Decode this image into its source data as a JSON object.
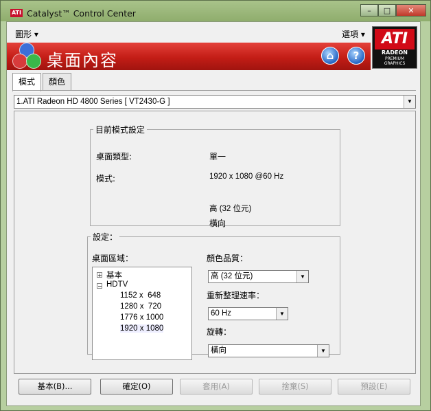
{
  "window": {
    "title": "Catalyst™ Control Center",
    "app_icon_text": "ATI",
    "minimize": "–",
    "maximize": "□",
    "close": "✕"
  },
  "menu": {
    "graphics": "圖形 ▾",
    "options": "選項 ▾"
  },
  "banner": {
    "title": "桌面內容",
    "home_icon": "home-icon",
    "help_icon": "help-icon",
    "help_glyph": "?",
    "home_glyph": "⌂"
  },
  "ati_logo": {
    "brand": "ATI",
    "line1": "RADEON",
    "line2": "PREMIUM",
    "line3": "GRAPHICS"
  },
  "tabs": [
    {
      "label": "模式"
    },
    {
      "label": "顏色"
    }
  ],
  "display_select": {
    "value": "1.ATI Radeon HD 4800 Series    [ VT2430-G ]"
  },
  "current_mode": {
    "legend": "目前模式設定",
    "desktop_type_label": "桌面類型:",
    "desktop_type_value": "單一",
    "mode_label": "模式:",
    "mode_value": "1920 x 1080 @60 Hz",
    "color_value": "高 (32 位元)",
    "rotation_value": "橫向"
  },
  "settings": {
    "legend": "設定：",
    "desktop_area_label": "桌面區域：",
    "tree": [
      {
        "label": "基本",
        "expander": "+"
      },
      {
        "label": "HDTV",
        "expander": "−"
      },
      {
        "label": "1152 x  648"
      },
      {
        "label": "1280 x  720"
      },
      {
        "label": "1776 x 1000"
      },
      {
        "label": "1920 x 1080"
      }
    ],
    "color_quality_label": "顏色品質：",
    "color_quality_value": "高 (32 位元)",
    "refresh_label": "重新整理速率：",
    "refresh_value": "60 Hz",
    "rotation_label": "旋轉：",
    "rotation_value": "橫向"
  },
  "buttons": {
    "basic": "基本(B)...",
    "ok": "確定(O)",
    "apply": "套用(A)",
    "discard": "捨棄(S)",
    "defaults": "預設(E)"
  }
}
